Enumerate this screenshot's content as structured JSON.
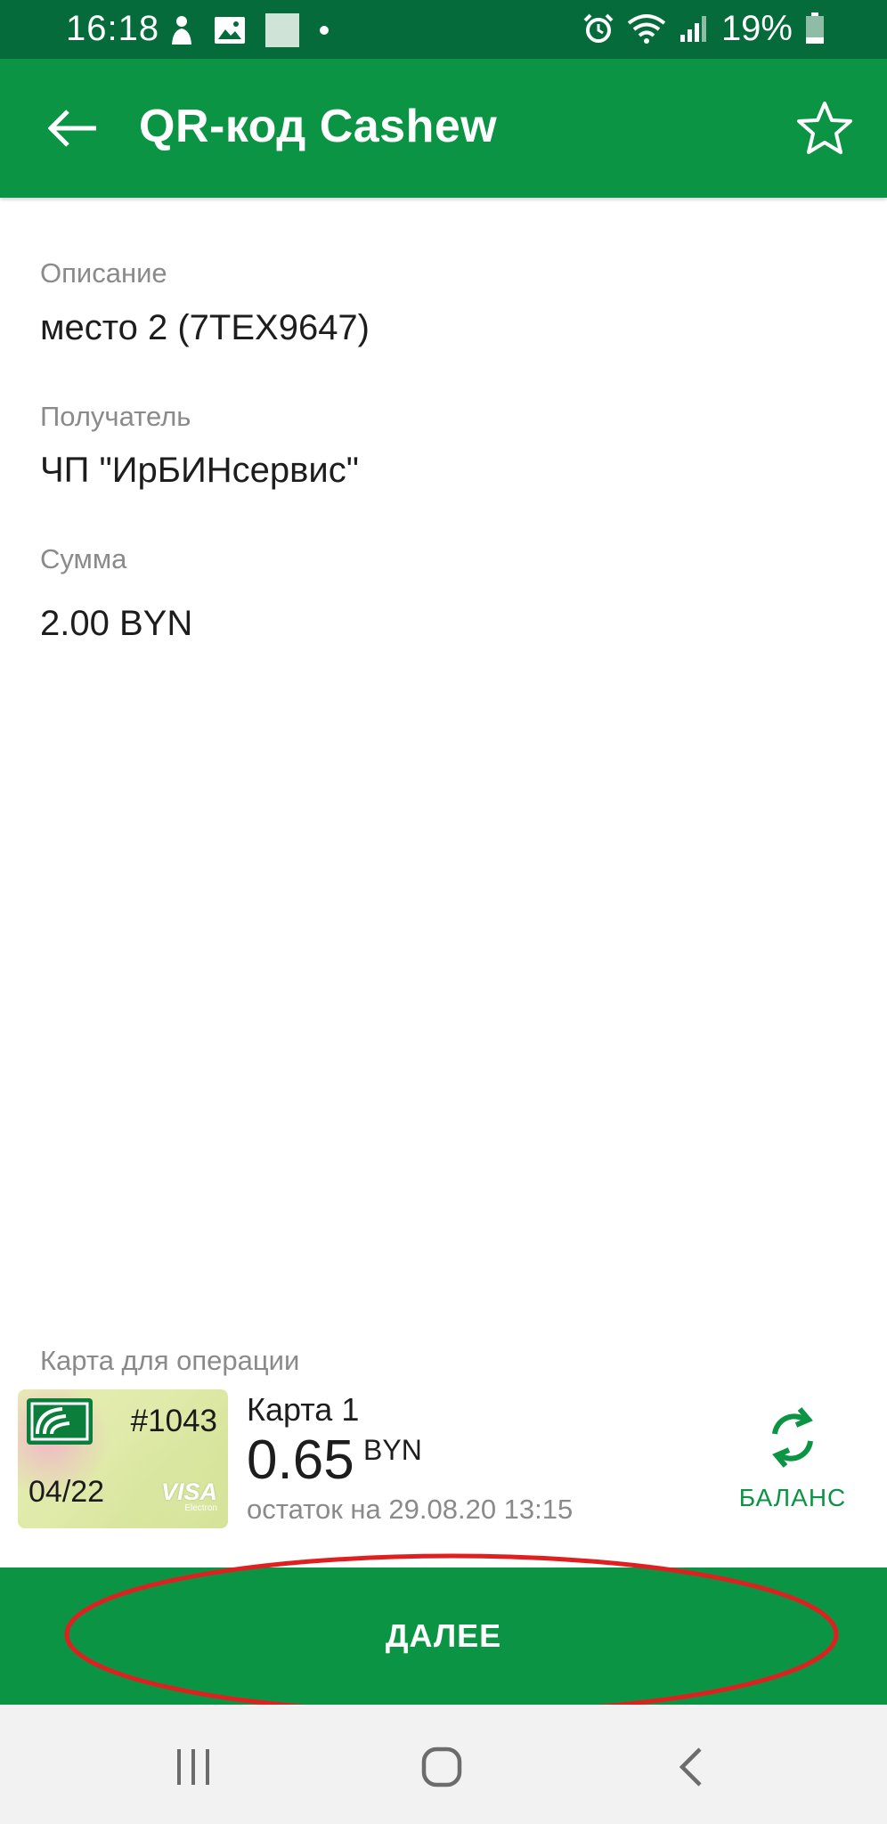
{
  "status_bar": {
    "time": "16:18",
    "battery": "19%"
  },
  "app_bar": {
    "title": "QR-код Cashew"
  },
  "details": {
    "description_label": "Описание",
    "description_value": "место 2 (7TEX9647)",
    "recipient_label": "Получатель",
    "recipient_value": "ЧП \"ИрБИНсервис\"",
    "amount_label": "Сумма",
    "amount_value": "2.00 BYN"
  },
  "card": {
    "section_label": "Карта для операции",
    "number": "#1043",
    "expiry": "04/22",
    "brand": "VISA",
    "brand_sub": "Electron",
    "name": "Карта 1",
    "balance": "0.65",
    "currency": "BYN",
    "remainder": "остаток на 29.08.20 13:15",
    "balance_button": "БАЛАНС"
  },
  "next_button": "ДАЛЕЕ",
  "colors": {
    "status_bar": "#056b3b",
    "primary": "#0b9444",
    "highlight": "#e02020"
  }
}
